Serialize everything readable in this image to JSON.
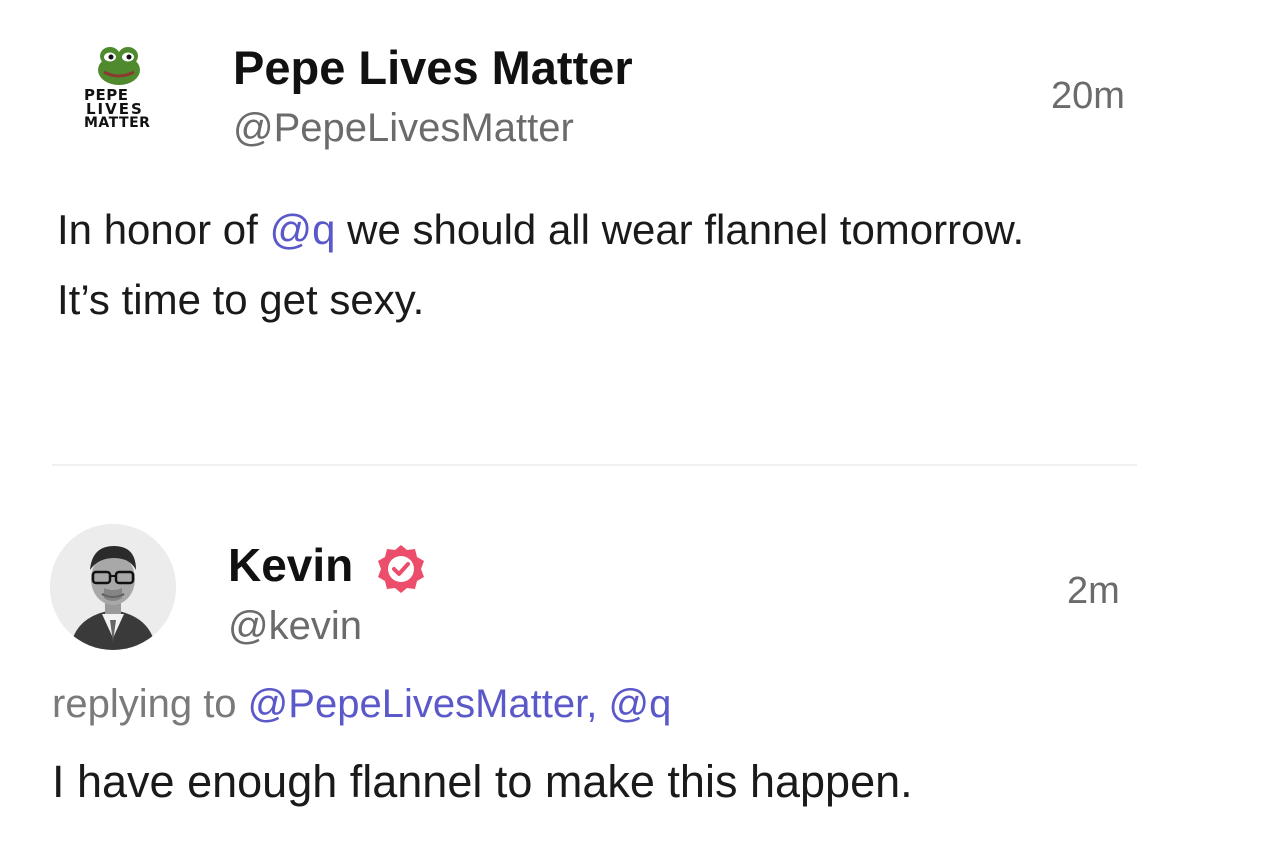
{
  "posts": [
    {
      "author": {
        "display_name": "Pepe Lives Matter",
        "handle": "@PepeLivesMatter",
        "avatar_text": [
          "PEPE",
          "LIVES",
          "MATTER"
        ],
        "avatar_icon": "frog-logo-icon"
      },
      "time": "20m",
      "body": {
        "segment1": "In honor of ",
        "mention": "@q",
        "segment2": " we should all wear flannel tomorrow.",
        "line2": "It’s time to get sexy."
      }
    },
    {
      "author": {
        "display_name": "Kevin",
        "handle": "@kevin",
        "verified_badge_icon": "verified-badge-icon",
        "avatar_icon": "profile-photo-avatar"
      },
      "time": "2m",
      "replying_to": {
        "prefix": "replying to ",
        "mention1": "@PepeLivesMatter",
        "separator": ", ",
        "mention2": "@q"
      },
      "body": "I have enough flannel to make this happen."
    }
  ],
  "colors": {
    "mention": "#5b58c9",
    "secondary_text": "#6b6b6b",
    "verified_badge": "#ec4d6a",
    "frog_green": "#4f8a2e"
  }
}
